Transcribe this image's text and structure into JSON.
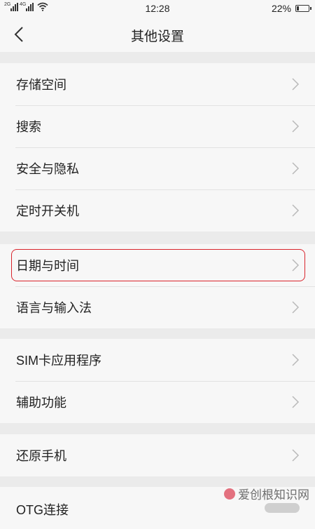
{
  "status_bar": {
    "sim1": "2G",
    "sim2": "4G",
    "time": "12:28",
    "battery_text": "22%",
    "battery_level": 0.22
  },
  "header": {
    "title": "其他设置"
  },
  "groups": [
    {
      "items": [
        {
          "label": "存储空间"
        },
        {
          "label": "搜索"
        },
        {
          "label": "安全与隐私"
        },
        {
          "label": "定时开关机"
        }
      ]
    },
    {
      "items": [
        {
          "label": "日期与时间"
        },
        {
          "label": "语言与输入法"
        }
      ]
    },
    {
      "items": [
        {
          "label": "SIM卡应用程序"
        },
        {
          "label": "辅助功能"
        }
      ]
    },
    {
      "items": [
        {
          "label": "还原手机"
        }
      ]
    },
    {
      "items": [
        {
          "label": "OTG连接"
        }
      ]
    }
  ],
  "watermark": {
    "text": "爱创根知识网"
  },
  "colors": {
    "highlight": "#d9242c",
    "background": "#ebebeb",
    "row_bg": "#f7f7f7"
  }
}
